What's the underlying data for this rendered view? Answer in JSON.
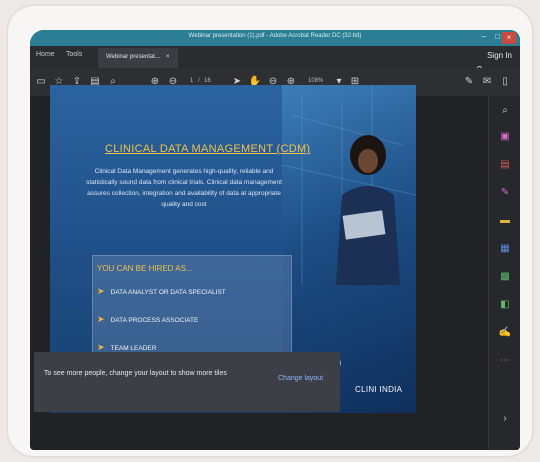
{
  "window": {
    "title": "Webinar presentation (1).pdf - Adobe Acrobat Reader DC (32-bit)"
  },
  "menu": {
    "home": "Home",
    "tools": "Tools",
    "doc_tab": "Webinar presentat...",
    "doc_tab_close": "×"
  },
  "toolbar": {
    "page": "1",
    "page_sep": "/",
    "page_total": "16",
    "zoom": "108%"
  },
  "account": {
    "sign_in": "Sign In"
  },
  "slide": {
    "title": "CLINICAL DATA MANAGEMENT (CDM)",
    "body": "Clinical Data Management generates high-quality, reliable and statistically sound data from clinical trials. Clinical data management assures collection, integration and availability of data at appropriate quality and cost",
    "hire_title": "YOU CAN BE HIRED AS...",
    "hire_items": [
      "DATA ANALYST OR DATA SPECIALIST",
      "DATA PROCESS ASSOCIATE",
      "TEAM LEADER"
    ],
    "brand": "CLINI INDIA"
  },
  "toast": {
    "message": "To see more people, change your layout to show more tiles",
    "action": "Change layout"
  },
  "colors": {
    "accent": "#2b7e93",
    "slide_title": "#f2c24a",
    "toast_link": "#8ab4f8"
  },
  "icons": {
    "toolbar": [
      "save-icon",
      "bookmark-icon",
      "upload-icon",
      "print-icon",
      "search-icon",
      "page-up-icon",
      "page-down-icon",
      "cursor-icon",
      "hand-icon",
      "zoom-out-icon",
      "zoom-in-icon",
      "fit-page-icon",
      "comment-icon",
      "sign-icon",
      "share-icon"
    ],
    "sidebar": [
      "zoom-icon",
      "export-pdf-icon",
      "create-pdf-icon",
      "edit-pdf-icon",
      "comment-icon",
      "combine-icon",
      "organize-icon",
      "protect-icon",
      "fill-sign-icon",
      "more-tools-icon",
      "expand-icon"
    ]
  }
}
